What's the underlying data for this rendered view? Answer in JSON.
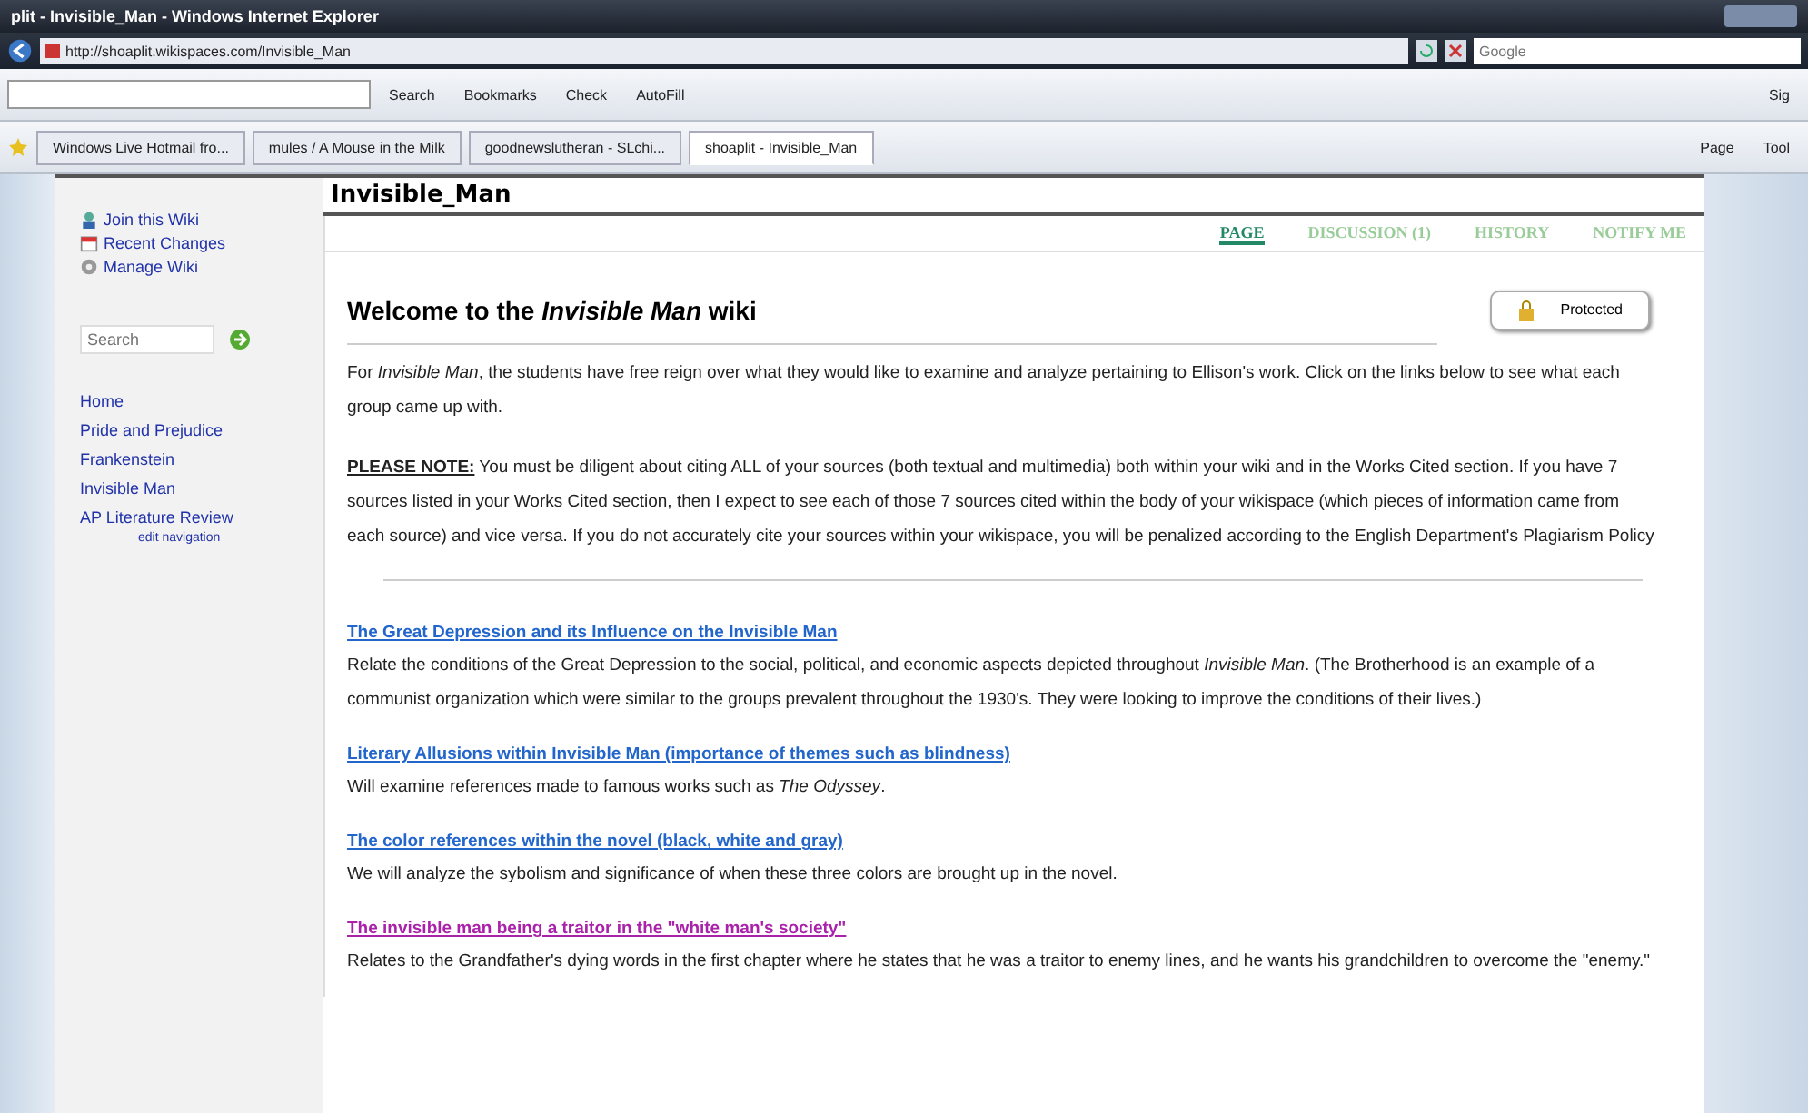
{
  "browser": {
    "title": "plit - Invisible_Man - Windows Internet Explorer",
    "address": "http://shoaplit.wikispaces.com/Invisible_Man",
    "search_placeholder": "Google",
    "toolbar": [
      "Search",
      "Bookmarks",
      "Check",
      "AutoFill"
    ],
    "tabs": [
      {
        "label": "Windows Live Hotmail fro...",
        "selected": false
      },
      {
        "label": "mules / A Mouse in the Milk",
        "selected": false
      },
      {
        "label": "goodnewslutheran - SLchi...",
        "selected": false
      },
      {
        "label": "shoaplit - Invisible_Man",
        "selected": true
      }
    ],
    "commands": [
      "Page",
      "Tool"
    ],
    "sign_in": "Sig"
  },
  "sidebar": {
    "actions": [
      {
        "kind": "join",
        "label": "Join this Wiki"
      },
      {
        "kind": "changes",
        "label": "Recent Changes"
      },
      {
        "kind": "manage",
        "label": "Manage Wiki"
      }
    ],
    "search_placeholder": "Search",
    "nav": [
      "Home",
      "Pride and Prejudice",
      "Frankenstein",
      "Invisible Man",
      "AP Literature Review"
    ],
    "edit_link": "edit navigation"
  },
  "page": {
    "title": "Invisible_Man",
    "tabs": [
      {
        "label": "PAGE",
        "selected": true
      },
      {
        "label": "DISCUSSION (1)",
        "selected": false
      },
      {
        "label": "HISTORY",
        "selected": false
      },
      {
        "label": "NOTIFY ME",
        "selected": false
      }
    ],
    "heading": "Welcome to the *Invisible Man* wiki",
    "protected": "Protected",
    "intro": "For *Invisible Man*, the students have free reign over what they would like to examine and analyze pertaining to Ellison's work. Click on the links below to see what each group came up with.",
    "note_label": "PLEASE NOTE:",
    "note": "You must be diligent about citing ALL of your sources (both textual and multimedia) both within your wiki and in the Works Cited section. If you have 7 sources listed in your Works Cited section, then I expect to see each of those 7 sources cited within the body of your wikispace (which pieces of information came from each source) and vice versa. If you do not accurately cite your sources within your wikispace, you will be penalized according to the English Department's Plagiarism Policy",
    "topics": [
      {
        "link": "The Great Depression and its Influence on the Invisible Man",
        "visited": false,
        "description": "Relate the conditions of the Great Depression to the social, political, and economic aspects depicted throughout *Invisible Man*. (The Brotherhood is an example of a communist organization which were similar to the groups prevalent throughout the 1930's. They were looking to improve the conditions of their lives.)"
      },
      {
        "link": "Literary Allusions within Invisible Man (importance of themes such as blindness)",
        "visited": false,
        "description": "Will examine references made to famous works such as *The Odyssey*."
      },
      {
        "link": "The color references within the novel (black, white and gray)",
        "visited": false,
        "description": "We will analyze the sybolism and significance of when these three colors are brought up in the novel."
      },
      {
        "link": "The invisible man being a traitor in the \"white man's society\"",
        "visited": true,
        "description": "Relates to the Grandfather's dying words in the first chapter where he states that he was a traitor to enemy lines, and he wants his grandchildren to overcome the \"enemy.\""
      }
    ]
  }
}
